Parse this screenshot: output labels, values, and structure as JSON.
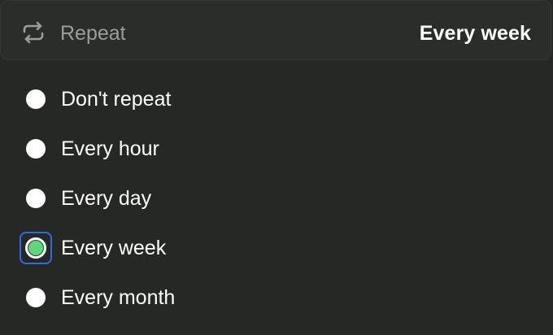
{
  "header": {
    "icon": "repeat-icon",
    "label": "Repeat",
    "value": "Every week"
  },
  "options": [
    {
      "label": "Don't repeat",
      "selected": false
    },
    {
      "label": "Every hour",
      "selected": false
    },
    {
      "label": "Every day",
      "selected": false
    },
    {
      "label": "Every week",
      "selected": true
    },
    {
      "label": "Every month",
      "selected": false
    }
  ],
  "colors": {
    "background": "#252825",
    "selected_fill": "#5fd67c",
    "focus_ring": "#2d6be0"
  }
}
